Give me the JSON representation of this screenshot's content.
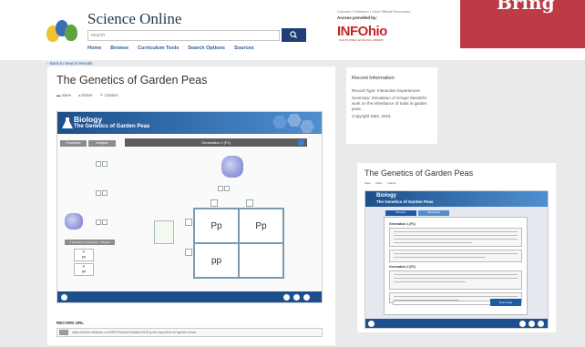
{
  "header": {
    "site_title": "Science Online",
    "search_placeholder": "search",
    "nav": [
      "Home",
      "Browse",
      "Curriculum Tools",
      "Search Options",
      "Sources"
    ],
    "top_links": "Connect / Publisher  |  View Official Resources",
    "access_provided": "Access provided by:",
    "partner": "INFOhio",
    "partner_sub": "OHIO'S PREK-12 DIGITAL LIBRARY",
    "promo_text": "Bring"
  },
  "breadcrumb": "Back to Search Results",
  "record": {
    "title": "The Genetics of Garden Peas",
    "actions": [
      "Save",
      "Share",
      "Citation"
    ],
    "record_url_label": "RECORD URL",
    "record_url": "https://online.infobase.com/HRC/Search/Details/2418?q=the+genetics+of+garden+peas"
  },
  "player": {
    "subject": "Biology",
    "title": "The Genetics of Garden Peas",
    "tabs": [
      "Procedure",
      "Analysis"
    ],
    "generation_label": "Generation 1 (F1)",
    "tag": "P (Purple) x pp (Green) - Original",
    "punnett": [
      "Pp",
      "Pp",
      "pp",
      ""
    ],
    "seed_labels": [
      "P",
      "pp",
      "P",
      "pp"
    ]
  },
  "info": {
    "heading": "Record Information",
    "lines": [
      "Record Type: Interactive Experiences",
      "Summary: Simulation of Gregor Mendel's work on the inheritance of traits in garden peas.",
      "Copyright Date: 2015"
    ]
  },
  "preview": {
    "title": "The Genetics of Garden Peas",
    "actions": [
      "Save",
      "Share",
      "Citation"
    ],
    "subject": "Biology",
    "subtitle": "The Genetics of Garden Peas",
    "tabs": [
      "Procedure",
      "Observation"
    ],
    "generations": [
      "Generation 1 (F1)",
      "Generation 2 (F2)"
    ],
    "button": "Next Level"
  },
  "colors": {
    "header_blue": "#1d4f8c",
    "accent_red": "#c5262c",
    "promo": "#bd3a47",
    "flower": "#8d91d9"
  }
}
